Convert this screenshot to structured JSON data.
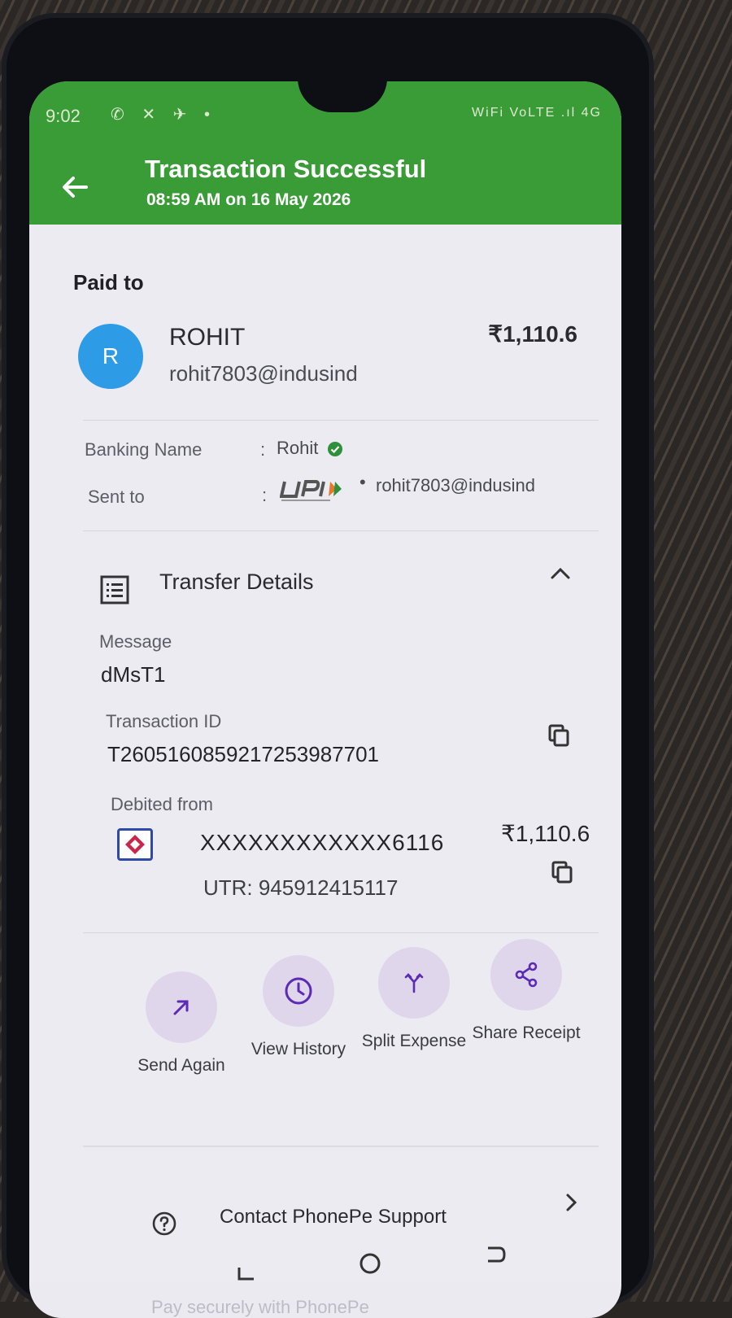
{
  "status_bar": {
    "time": "9:02",
    "left_icons": "✆ ✕ ✈ •",
    "right_icons": "WiFi VoLTE .ıl 4G"
  },
  "header": {
    "title": "Transaction Successful",
    "subtitle": "08:59 AM on 16 May 2026",
    "bg_color": "#3a9c36"
  },
  "paid_to": {
    "section_label": "Paid to",
    "avatar_initial": "R",
    "name": "ROHIT",
    "upi_id": "rohit7803@indusind",
    "amount": "₹1,110.6"
  },
  "details": {
    "banking_name_label": "Banking Name",
    "banking_name_value": "Rohit",
    "sent_to_label": "Sent to",
    "sent_to_value": "rohit7803@indusind",
    "colon": ":",
    "separator": "•"
  },
  "transfer": {
    "section_title": "Transfer Details",
    "message_label": "Message",
    "message_value": "dMsT1",
    "txn_label": "Transaction ID",
    "txn_value": "T2605160859217253987701",
    "debited_label": "Debited from",
    "account": "XXXXXXXXXXXX6116",
    "debited_amount": "₹1,110.6",
    "utr": "UTR: 945912415117"
  },
  "actions": [
    {
      "label": "Send Again",
      "icon": "arrow-up-right-icon"
    },
    {
      "label": "View History",
      "icon": "clock-icon"
    },
    {
      "label": "Split Expense",
      "icon": "split-icon"
    },
    {
      "label": "Share Receipt",
      "icon": "share-icon"
    }
  ],
  "support": {
    "label": "Contact PhonePe Support",
    "footer": "Pay securely with PhonePe"
  },
  "colors": {
    "accent_purple": "#5b2bb5",
    "action_bg": "#dfd6ec",
    "avatar_blue": "#2d9be6"
  }
}
